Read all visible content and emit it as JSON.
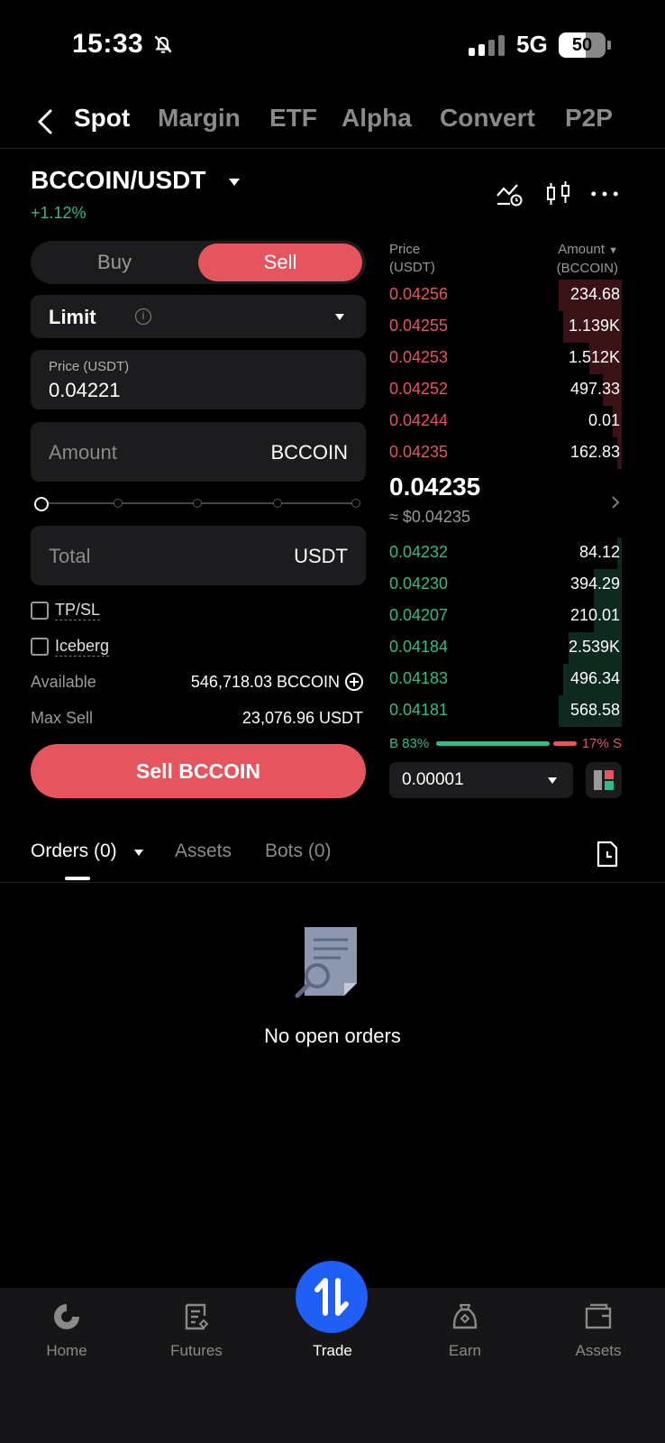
{
  "status": {
    "time": "15:33",
    "network": "5G",
    "battery": "50"
  },
  "nav": {
    "tabs": [
      "Spot",
      "Margin",
      "ETF",
      "Alpha",
      "Convert",
      "P2P"
    ],
    "active": "Spot"
  },
  "pair": {
    "name": "BCCOIN/USDT",
    "change": "+1.12%"
  },
  "form": {
    "buy_label": "Buy",
    "sell_label": "Sell",
    "order_type": "Limit",
    "price_label": "Price (USDT)",
    "price_value": "0.04221",
    "amount_placeholder": "Amount",
    "amount_unit": "BCCOIN",
    "total_placeholder": "Total",
    "total_unit": "USDT",
    "slider_percent": 0,
    "tpsl_label": "TP/SL",
    "iceberg_label": "Iceberg",
    "available_label": "Available",
    "available_value": "546,718.03 BCCOIN",
    "max_sell_label": "Max Sell",
    "max_sell_value": "23,076.96 USDT",
    "submit_label": "Sell BCCOIN"
  },
  "orderbook": {
    "price_header_1": "Price",
    "price_header_2": "(USDT)",
    "amount_header_1": "Amount",
    "amount_header_2": "(BCCOIN)",
    "asks": [
      {
        "price": "0.04256",
        "amount": "234.68",
        "depth": 0.27
      },
      {
        "price": "0.04255",
        "amount": "1.139K",
        "depth": 0.25
      },
      {
        "price": "0.04253",
        "amount": "1.512K",
        "depth": 0.14
      },
      {
        "price": "0.04252",
        "amount": "497.33",
        "depth": 0.08
      },
      {
        "price": "0.04244",
        "amount": "0.01",
        "depth": 0.04
      },
      {
        "price": "0.04235",
        "amount": "162.83",
        "depth": 0.02
      }
    ],
    "last_price": "0.04235",
    "last_price_usd": "≈ $0.04235",
    "bids": [
      {
        "price": "0.04232",
        "amount": "84.12",
        "depth": 0.02
      },
      {
        "price": "0.04230",
        "amount": "394.29",
        "depth": 0.12
      },
      {
        "price": "0.04207",
        "amount": "210.01",
        "depth": 0.12
      },
      {
        "price": "0.04184",
        "amount": "2.539K",
        "depth": 0.23
      },
      {
        "price": "0.04183",
        "amount": "496.34",
        "depth": 0.25
      },
      {
        "price": "0.04181",
        "amount": "568.58",
        "depth": 0.27
      }
    ],
    "buy_ratio": "B 83%",
    "sell_ratio": "17% S",
    "tick_size": "0.00001"
  },
  "orders": {
    "tabs": [
      "Orders (0)",
      "Assets",
      "Bots (0)"
    ],
    "empty_text": "No open orders"
  },
  "bottom_nav": {
    "items": [
      {
        "label": "Home",
        "icon": "home-icon"
      },
      {
        "label": "Futures",
        "icon": "futures-icon"
      },
      {
        "label": "Trade",
        "icon": "trade-icon"
      },
      {
        "label": "Earn",
        "icon": "earn-icon"
      },
      {
        "label": "Assets",
        "icon": "wallet-icon"
      }
    ]
  },
  "colors": {
    "sell": "#e5555e",
    "buy": "#2ebd85",
    "accent": "#1f5ff5",
    "surface": "#1c1c1e"
  }
}
